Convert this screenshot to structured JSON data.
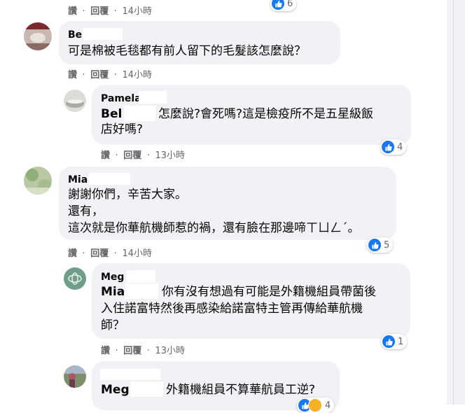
{
  "actions": {
    "like": "讚",
    "reply": "回覆",
    "sep": "·"
  },
  "comments": [
    {
      "time": "14小時",
      "reaction_count": "6"
    },
    {
      "name": "Be",
      "text": "可是棉被毛毯都有前人留下的毛髮該怎麼說？",
      "time": "14小時"
    },
    {
      "name": "Pamela",
      "tag": "Bel",
      "line1": "怎麼說?會死嗎?這是檢疫所不是五星級飯",
      "line2": "店好嗎?",
      "time": "13小時",
      "reaction_count": "4"
    },
    {
      "name": "Mia",
      "line1": "謝謝你們，辛苦大家。",
      "line2": "還有，",
      "line3": "這次就是你華航機師惹的禍，還有臉在那邊啼ㄒㄩㄥˊ。",
      "time": "14小時",
      "reaction_count": "5"
    },
    {
      "name": "Meg",
      "tag": "Mia",
      "line1": "你有沒有想過有可能是外籍機組員帶菌後",
      "line2": "入住諾富特然後再感染給諾富特主管再傳給華航機",
      "line3": "師？",
      "time": "13小時",
      "reaction_count": "1"
    },
    {
      "tag": "Meg",
      "line1": "外籍機組員不算華航員工逆?",
      "reaction_count": "4"
    }
  ],
  "colors": {
    "like_blue": "#1877f2",
    "bubble_bg": "#f0f2f5",
    "meta_gray": "#65676b"
  }
}
